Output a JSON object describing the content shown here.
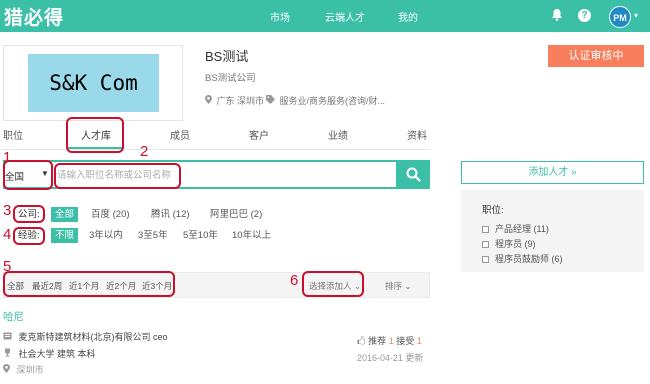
{
  "topbar": {
    "logo": "猎必得",
    "nav": [
      "市场",
      "云端人才",
      "我的"
    ],
    "bell_icon": "bell-icon",
    "help": "?",
    "avatar": "PM"
  },
  "company": {
    "logo_text": "S&K Com",
    "name": "BS测试",
    "full_name": "BS测试公司",
    "location": "广东 深圳市",
    "industry": "服务业/商务服务(咨询/财..."
  },
  "cert_button": "认证审核中",
  "tabs": [
    "职位",
    "人才库",
    "成员",
    "客户",
    "业绩",
    "资料"
  ],
  "search": {
    "region": "全国",
    "placeholder": "请输入职位名称或公司名称"
  },
  "filters": {
    "company_label": "公司:",
    "company_options": [
      "全部",
      "百度 (20)",
      "腾讯 (12)",
      "阿里巴巴 (2)"
    ],
    "experience_label": "经验:",
    "experience_options": [
      "不限",
      "3年以内",
      "3至5年",
      "5至10年",
      "10年以上"
    ]
  },
  "sortbar": {
    "time_options": [
      "全部",
      "最近2周",
      "近1个月",
      "近2个月",
      "近3个月"
    ],
    "added_by": "选择添加人",
    "sort": "排序"
  },
  "candidate": {
    "name": "哈尼",
    "job": "麦克斯特建筑材料(北京)有限公司 ceo",
    "education": "社会大学 建筑 本科",
    "location": "深圳市",
    "recommend_label": "推荐",
    "recommend_count": "1",
    "accept_label": "接受",
    "accept_count": "1",
    "date": "2016-04-21 更新"
  },
  "sidebar": {
    "add_talent": "添加人才 »",
    "position_title": "职位:",
    "positions": [
      "产品经理 (11)",
      "程序员 (9)",
      "程序员鼓励师 (6)"
    ]
  },
  "annotations": [
    "1",
    "2",
    "3",
    "4",
    "5",
    "6"
  ],
  "colors": {
    "brand": "#3cbfa7",
    "accent": "#f67e5c",
    "annotation": "#c8102e"
  }
}
